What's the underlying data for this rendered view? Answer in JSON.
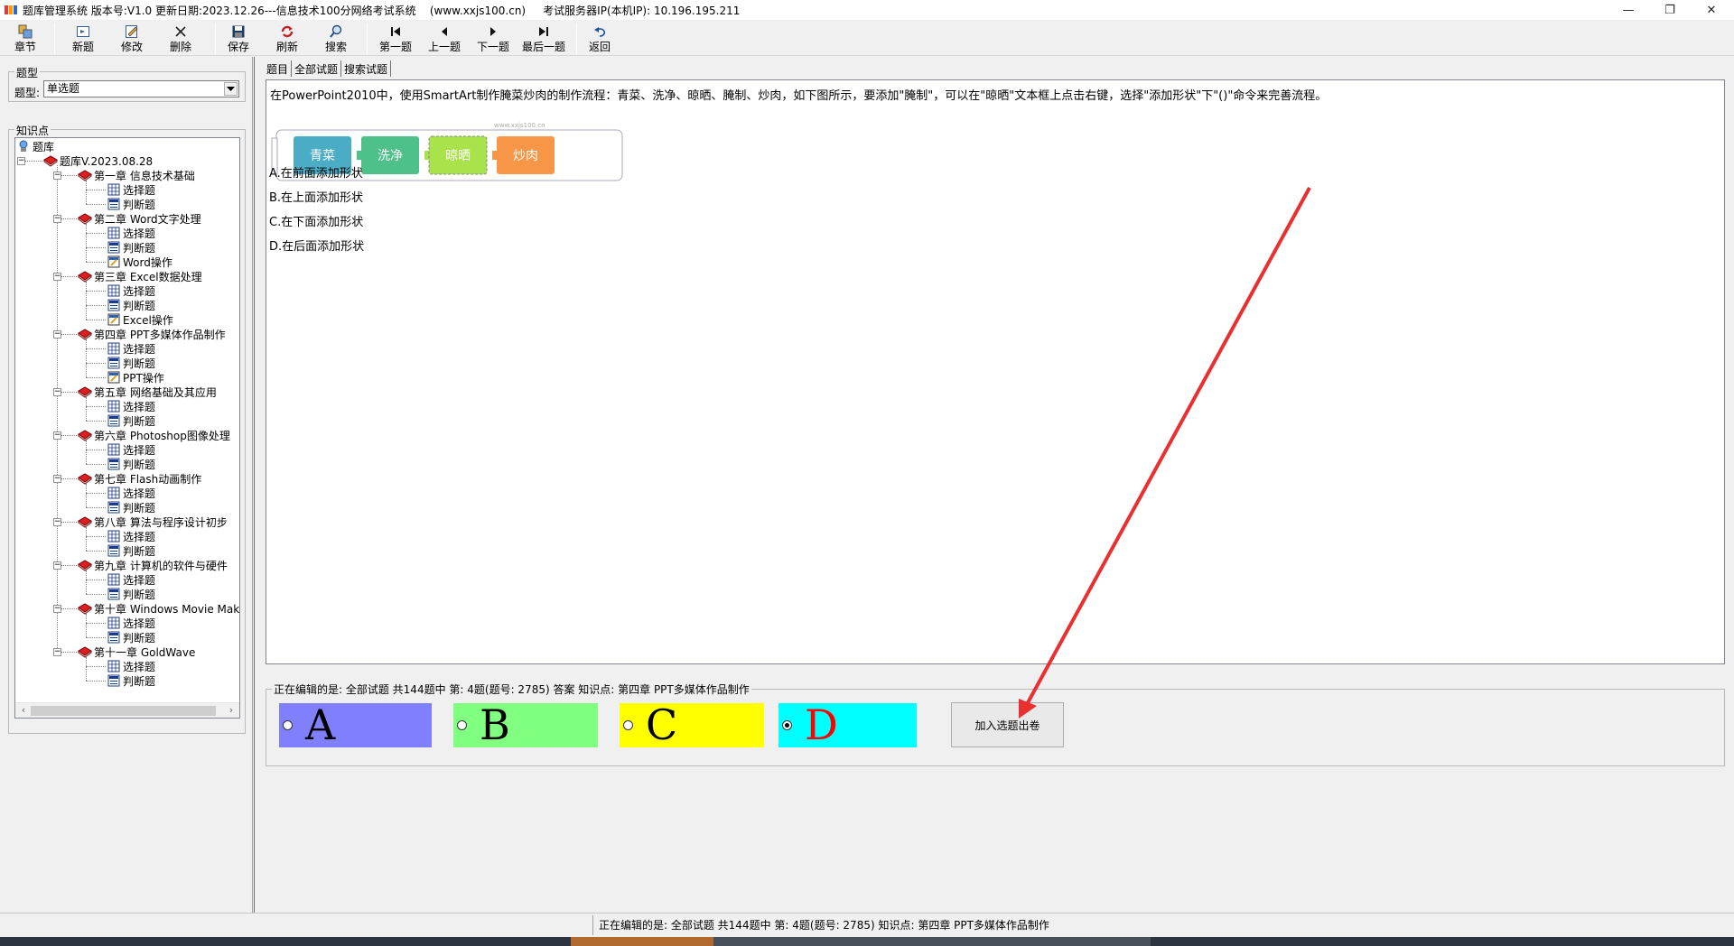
{
  "window": {
    "title": "题库管理系统 版本号:V1.0 更新日期:2023.12.26---信息技术100分网络考试系统    (www.xxjs100.cn)     考试服务器IP(本机IP): 10.196.195.211",
    "minimize": "—",
    "restore": "❐",
    "close": "✕"
  },
  "toolbar": {
    "chapter": "章节",
    "new": "新题",
    "edit": "修改",
    "delete": "删除",
    "save": "保存",
    "refresh": "刷新",
    "search": "搜索",
    "first": "第一题",
    "prev": "上一题",
    "next": "下一题",
    "last": "最后一题",
    "back": "返回"
  },
  "left": {
    "type_group": "题型",
    "type_label": "题型:",
    "type_value": "单选题",
    "knowledge_group": "知识点"
  },
  "tree": {
    "root": "题库",
    "bank": "题库V.2023.08.28",
    "chapters": [
      {
        "label": "第一章 信息技术基础",
        "children": [
          "选择题",
          "判断题"
        ]
      },
      {
        "label": "第二章 Word文字处理",
        "children": [
          "选择题",
          "判断题",
          "Word操作"
        ]
      },
      {
        "label": "第三章 Excel数据处理",
        "children": [
          "选择题",
          "判断题",
          "Excel操作"
        ]
      },
      {
        "label": "第四章 PPT多媒体作品制作",
        "children": [
          "选择题",
          "判断题",
          "PPT操作"
        ]
      },
      {
        "label": "第五章 网络基础及其应用",
        "children": [
          "选择题",
          "判断题"
        ]
      },
      {
        "label": "第六章 Photoshop图像处理",
        "children": [
          "选择题",
          "判断题"
        ]
      },
      {
        "label": "第七章 Flash动画制作",
        "children": [
          "选择题",
          "判断题"
        ]
      },
      {
        "label": "第八章 算法与程序设计初步",
        "children": [
          "选择题",
          "判断题"
        ]
      },
      {
        "label": "第九章 计算机的软件与硬件",
        "children": [
          "选择题",
          "判断题"
        ]
      },
      {
        "label": "第十章 Windows Movie Make",
        "children": [
          "选择题",
          "判断题"
        ]
      },
      {
        "label": "第十一章 GoldWave",
        "children": [
          "选择题",
          "判断题"
        ]
      }
    ],
    "scroll_left": "‹",
    "scroll_right": "›"
  },
  "tabs": [
    "题目",
    "全部试题",
    "搜索试题"
  ],
  "question": {
    "text": "在PowerPoint2010中，使用SmartArt制作腌菜炒肉的制作流程：青菜、洗净、晾晒、腌制、炒肉，如下图所示，要添加\"腌制\"，可以在\"晾晒\"文本框上点击右键，选择\"添加形状\"下\"()\"命令来完善流程。",
    "options": [
      "A.在前面添加形状",
      "B.在上面添加形状",
      "C.在下面添加形状",
      "D.在后面添加形状"
    ],
    "diagram": {
      "watermark": "www.xxjs100.cn",
      "steps": [
        {
          "label": "青菜",
          "color": "#4bacc6"
        },
        {
          "label": "洗净",
          "color": "#4ec08a"
        },
        {
          "label": "晾晒",
          "color": "#a9e34b"
        },
        {
          "label": "炒肉",
          "color": "#f79646"
        }
      ]
    }
  },
  "edit": {
    "legend": "正在编辑的是: 全部试题 共144题中   第: 4题(题号: 2785) 答案 知识点: 第四章 PPT多媒体作品制作",
    "answers": [
      {
        "letter": "A",
        "color": "#8080ff",
        "text_color": "#000000",
        "selected": false
      },
      {
        "letter": "B",
        "color": "#80ff80",
        "text_color": "#000000",
        "selected": false
      },
      {
        "letter": "C",
        "color": "#ffff00",
        "text_color": "#000000",
        "selected": false
      },
      {
        "letter": "D",
        "color": "#00ffff",
        "text_color": "#ff0000",
        "selected": true
      }
    ],
    "add_button": "加入选题出卷"
  },
  "status": {
    "text": "正在编辑的是: 全部试题 共144题中   第: 4题(题号: 2785)   知识点: 第四章 PPT多媒体作品制作"
  },
  "colors": {
    "annotation_arrow": "#e83030"
  }
}
